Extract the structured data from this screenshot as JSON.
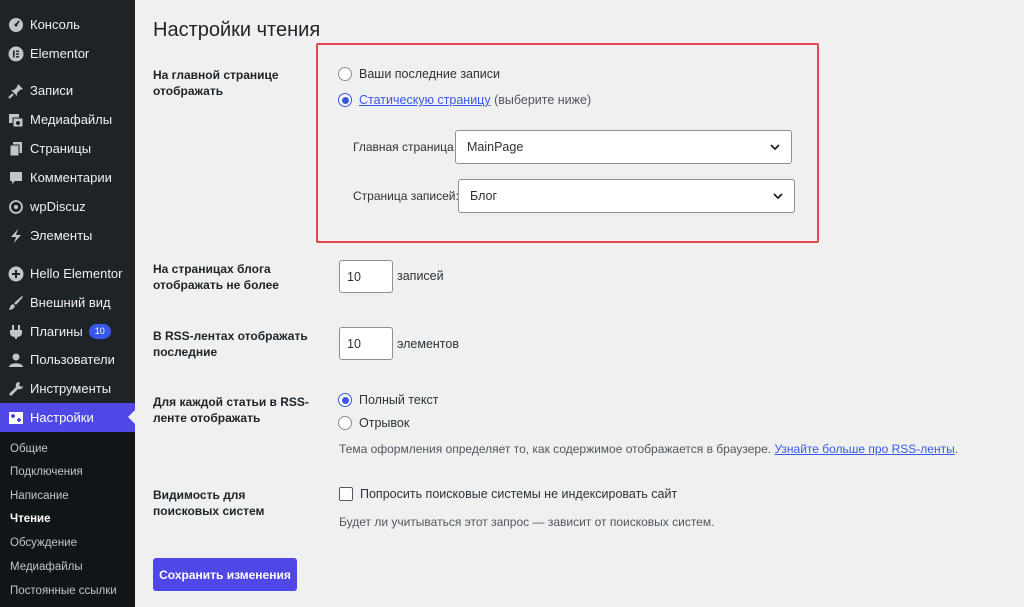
{
  "sidebar": {
    "items": [
      {
        "label": "Консоль",
        "icon": "dashboard-icon"
      },
      {
        "label": "Elementor",
        "icon": "elementor-icon"
      },
      {
        "label": "Записи",
        "icon": "pin-icon"
      },
      {
        "label": "Медиафайлы",
        "icon": "media-icon"
      },
      {
        "label": "Страницы",
        "icon": "pages-icon"
      },
      {
        "label": "Комментарии",
        "icon": "comment-icon"
      },
      {
        "label": "wpDiscuz",
        "icon": "wpdiscuz-icon"
      },
      {
        "label": "Элементы",
        "icon": "elements-icon"
      },
      {
        "label": "Hello Elementor",
        "icon": "plus-circle-icon"
      },
      {
        "label": "Внешний вид",
        "icon": "brush-icon"
      },
      {
        "label": "Плагины",
        "icon": "plugin-icon",
        "badge": "10"
      },
      {
        "label": "Пользователи",
        "icon": "user-icon"
      },
      {
        "label": "Инструменты",
        "icon": "wrench-icon"
      },
      {
        "label": "Настройки",
        "icon": "settings-icon"
      }
    ],
    "submenu": [
      "Общие",
      "Подключения",
      "Написание",
      "Чтение",
      "Обсуждение",
      "Медиафайлы",
      "Постоянные ссылки"
    ]
  },
  "page": {
    "title": "Настройки чтения",
    "homepage_display": {
      "label": "На главной странице отображать",
      "option_latest": "Ваши последние записи",
      "option_static_link": "Статическую страницу",
      "option_static_suffix": "(выберите ниже)",
      "selected": "static",
      "front_page_label": "Главная страница:",
      "front_page_value": "MainPage",
      "posts_page_label": "Страница записей:",
      "posts_page_value": "Блог"
    },
    "blog_pages": {
      "label": "На страницах блога отображать не более",
      "value": "10",
      "suffix": "записей"
    },
    "rss_items": {
      "label": "В RSS-лентах отображать последние",
      "value": "10",
      "suffix": "элементов"
    },
    "rss_content": {
      "label": "Для каждой статьи в RSS-ленте отображать",
      "option_full": "Полный текст",
      "option_excerpt": "Отрывок",
      "selected": "full",
      "description": "Тема оформления определяет то, как содержимое отображается в браузере.",
      "description_link": "Узнайте больше про RSS-ленты",
      "description_end": "."
    },
    "search_visibility": {
      "label": "Видимость для поисковых систем",
      "checkbox_label": "Попросить поисковые системы не индексировать сайт",
      "checked": false,
      "description": "Будет ли учитываться этот запрос — зависит от поисковых систем."
    },
    "save_button": "Сохранить изменения"
  },
  "colors": {
    "sidebar_bg": "#1d2327",
    "accent": "#4f47e6",
    "link": "#3858e9",
    "highlight_border": "#e0484b",
    "page_bg": "#f0f0f1"
  }
}
